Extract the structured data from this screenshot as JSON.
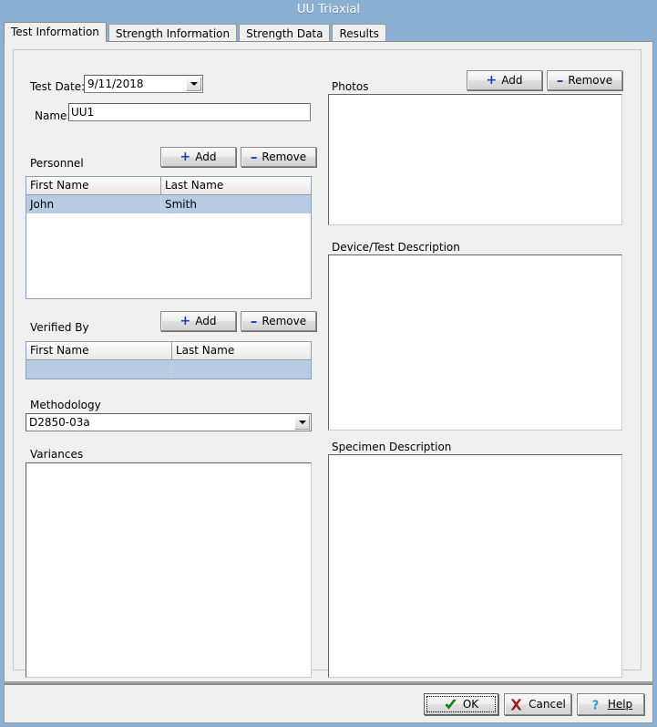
{
  "window": {
    "title": "UU Triaxial"
  },
  "tabs": [
    {
      "label": "Test Information",
      "active": true
    },
    {
      "label": "Strength Information",
      "active": false
    },
    {
      "label": "Strength Data",
      "active": false
    },
    {
      "label": "Results",
      "active": false
    }
  ],
  "left": {
    "test_date_label": "Test Date:",
    "test_date_value": "9/11/2018",
    "name_label": "Name:",
    "name_value": "UU1",
    "personnel": {
      "label": "Personnel",
      "add_label": "Add",
      "remove_label": "Remove",
      "columns": [
        "First Name",
        "Last Name"
      ],
      "rows": [
        {
          "first": "John",
          "last": "Smith",
          "selected": true
        }
      ]
    },
    "verified_by": {
      "label": "Verified By",
      "add_label": "Add",
      "remove_label": "Remove",
      "columns": [
        "First Name",
        "Last Name"
      ],
      "rows": [
        {
          "first": "",
          "last": "",
          "selected": true
        }
      ]
    },
    "methodology": {
      "label": "Methodology",
      "value": "D2850-03a"
    },
    "variances": {
      "label": "Variances",
      "value": ""
    }
  },
  "right": {
    "photos": {
      "label": "Photos",
      "add_label": "Add",
      "remove_label": "Remove",
      "value": ""
    },
    "device_test_description": {
      "label": "Device/Test Description",
      "value": ""
    },
    "specimen_description": {
      "label": "Specimen Description",
      "value": ""
    }
  },
  "footer": {
    "ok_label": "OK",
    "cancel_label": "Cancel",
    "help_label": "Help"
  },
  "icons": {
    "plus": "+",
    "minus": "–"
  },
  "colors": {
    "titlebar": "#8bb0d2",
    "selection": "#b8cce4",
    "accent_blue": "#1e3fbf",
    "ok_green": "#0f9d0f",
    "cancel_red": "#b01818",
    "help_cyan": "#1e9ec8"
  }
}
